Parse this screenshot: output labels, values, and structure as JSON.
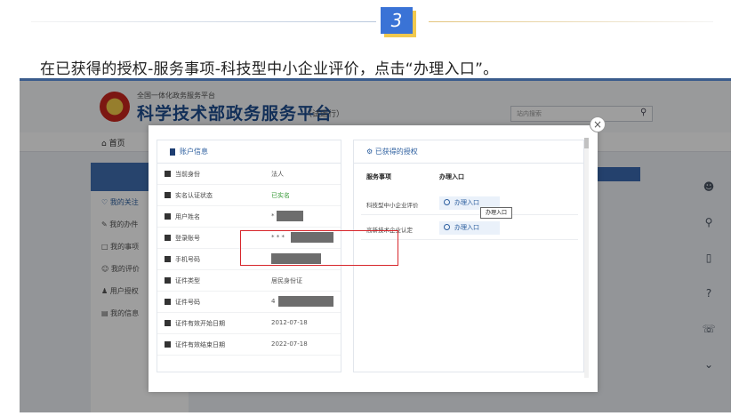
{
  "step": {
    "number": "3"
  },
  "instruction": "在已获得的授权-服务事项-科技型中小企业评价，点击“办理入口”。",
  "site": {
    "subtitle": "全国一体化政务服务平台",
    "title": "科学技术部政务服务平台",
    "tag": "（试运行）",
    "search_placeholder": "站内搜索",
    "nav_home": "首页"
  },
  "sidebar": {
    "items": [
      {
        "label": "我的关注",
        "icon": "heart-icon"
      },
      {
        "label": "我的办件",
        "icon": "pen-icon"
      },
      {
        "label": "我的事项",
        "icon": "folder-icon"
      },
      {
        "label": "我的评价",
        "icon": "smile-icon"
      },
      {
        "label": "用户授权",
        "icon": "users-icon"
      },
      {
        "label": "我的信息",
        "icon": "card-icon"
      }
    ]
  },
  "modal": {
    "account_panel": {
      "title": "账户信息",
      "rows": [
        {
          "label": "当前身份",
          "value": "法人",
          "icon": "id-icon"
        },
        {
          "label": "实名认证状态",
          "value": "已实名",
          "icon": "id-icon"
        },
        {
          "label": "用户姓名",
          "value": "*",
          "icon": "user-icon"
        },
        {
          "label": "登录账号",
          "value": "* * *",
          "icon": "id-icon"
        },
        {
          "label": "手机号码",
          "value": "",
          "icon": "phone-icon"
        },
        {
          "label": "证件类型",
          "value": "居民身份证",
          "icon": "card-icon"
        },
        {
          "label": "证件号码",
          "value": "4",
          "icon": "card-icon"
        },
        {
          "label": "证件有效开始日期",
          "value": "2012-07-18",
          "icon": "calendar-icon"
        },
        {
          "label": "证件有效结束日期",
          "value": "2022-07-18",
          "icon": "calendar-icon"
        }
      ]
    },
    "auth_panel": {
      "title": "已获得的授权",
      "col_service": "服务事项",
      "col_entry": "办理入口",
      "rows": [
        {
          "service": "科技型中小企业评价",
          "entry": "办理入口"
        },
        {
          "service": "高新技术企业认定",
          "entry": "办理入口"
        }
      ],
      "tooltip": "办理入口"
    }
  },
  "colors": {
    "accent": "#3a73d6",
    "highlight": "#d7262b",
    "brand": "#1d4d8f"
  }
}
